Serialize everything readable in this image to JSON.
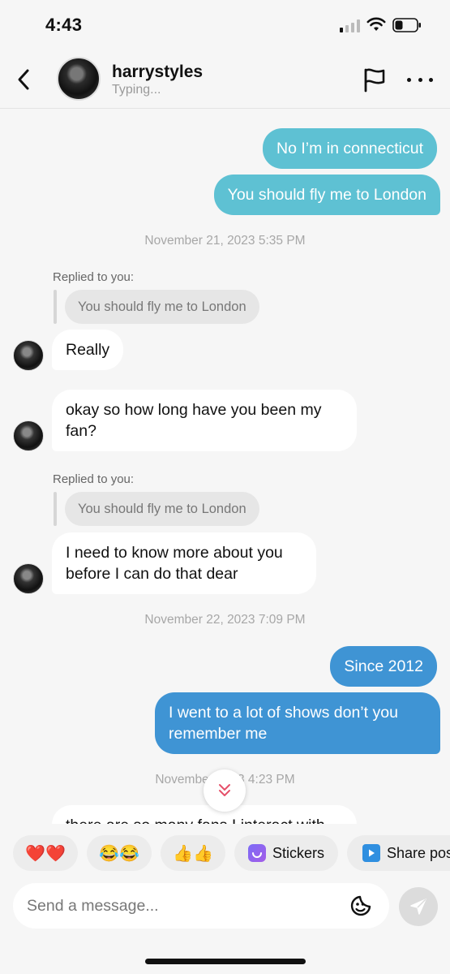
{
  "status_bar": {
    "time": "4:43",
    "icons": [
      "cellular-signal-icon",
      "wifi-icon",
      "battery-icon"
    ]
  },
  "header": {
    "back_icon": "chevron-left-icon",
    "username": "harrystyles",
    "status": "Typing...",
    "flag_icon": "flag-icon",
    "more_icon": "more-horizontal-icon"
  },
  "messages": [
    {
      "type": "out",
      "text": "No I’m in connecticut"
    },
    {
      "type": "out",
      "text": "You should fly me to London"
    },
    {
      "type": "timestamp",
      "text": "November 21, 2023 5:35 PM"
    },
    {
      "type": "in",
      "replied_label": "Replied to you:",
      "quote": "You should fly me to London",
      "text": "Really"
    },
    {
      "type": "in",
      "text": "okay so how long have you been my fan?"
    },
    {
      "type": "in",
      "replied_label": "Replied to you:",
      "quote": "You should fly me to London",
      "text": "I need to know more about you before I can do that dear"
    },
    {
      "type": "timestamp",
      "text": "November 22, 2023 7:09 PM"
    },
    {
      "type": "out",
      "text": "Since 2012"
    },
    {
      "type": "out",
      "text": "I went to a lot of shows don’t you remember me"
    },
    {
      "type": "timestamp",
      "text": "November 2  23 4:23 PM"
    },
    {
      "type": "in",
      "text": "there are so many fans I interact with"
    }
  ],
  "scroll_down_icon": "double-chevron-down-icon",
  "quick_replies": [
    {
      "label": "❤️❤️"
    },
    {
      "label": "😂😂"
    },
    {
      "label": "👍👍"
    },
    {
      "label": "Stickers",
      "icon": "stickers-icon"
    },
    {
      "label": "Share pos",
      "icon": "share-post-icon"
    }
  ],
  "composer": {
    "placeholder": "Send a message...",
    "emoji_icon": "sticker-face-icon",
    "send_icon": "send-icon"
  },
  "colors": {
    "outgoing_teal": "#5ec1d3",
    "outgoing_blue": "#3f94d4",
    "incoming": "#ffffff",
    "background": "#f6f6f6",
    "accent_red": "#e5506a"
  }
}
